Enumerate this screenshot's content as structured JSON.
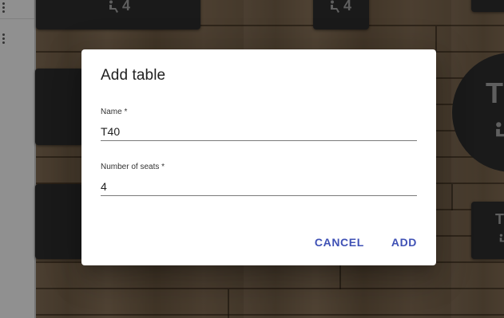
{
  "floor_tables": [
    {
      "seats": "4"
    },
    {
      "seats": "4"
    },
    {
      "label": "T"
    },
    {
      "label": "T"
    }
  ],
  "dialog": {
    "title": "Add table",
    "name_field": {
      "label": "Name *",
      "value": "T40"
    },
    "seats_field": {
      "label": "Number of seats *",
      "value": "4"
    },
    "cancel_label": "CANCEL",
    "add_label": "ADD"
  },
  "colors": {
    "accent": "#3f51b5",
    "table": "#2b2b2b",
    "dialog_bg": "#ffffff"
  },
  "icons": {
    "seat": "seat-icon",
    "menu": "more-vert-icon"
  }
}
